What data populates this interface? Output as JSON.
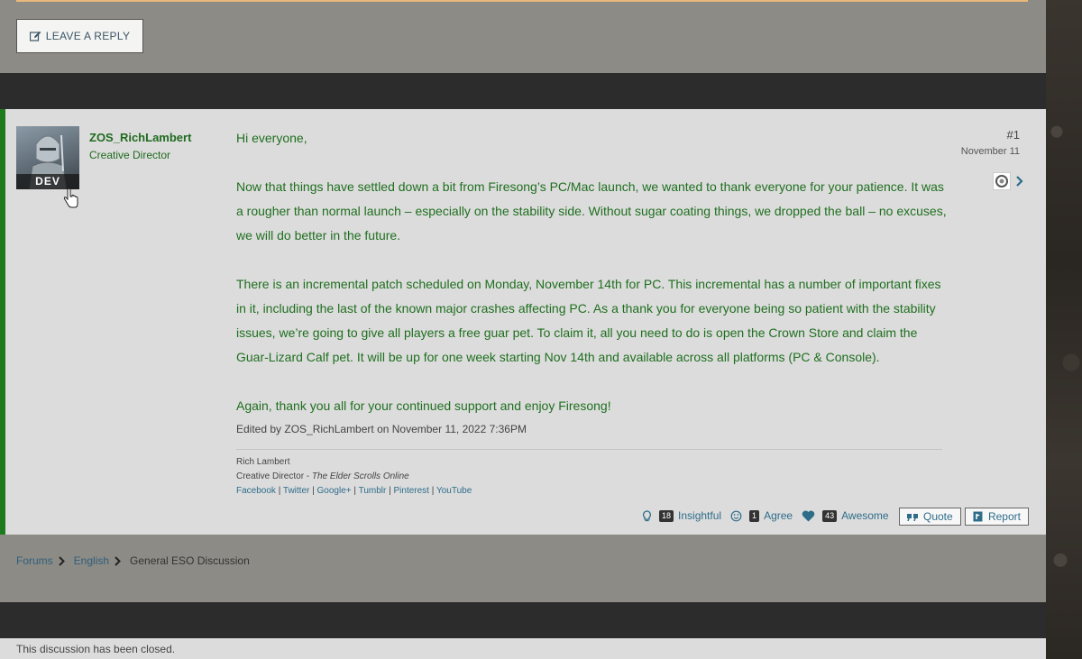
{
  "reply_button": {
    "label": "LEAVE A REPLY"
  },
  "post": {
    "author": {
      "name": "ZOS_RichLambert",
      "role": "Creative Director",
      "badge": "DEV"
    },
    "number": "#1",
    "date": "November 11",
    "paragraphs": [
      "Hi everyone,",
      "Now that things have settled down a bit from Firesong’s PC/Mac launch, we wanted to thank everyone for your patience. It was a rougher than normal launch – especially on the stability side. Without sugar coating things, we dropped the ball – no excuses, we will do better in the future.",
      "There is an incremental patch scheduled on Monday, November 14th for PC. This incremental has a number of important fixes in it, including the last of the known major crashes affecting PC. As a thank you for everyone being so patient with the stability issues, we’re going to give all players a free guar pet. To claim it, all you need to do is open the Crown Store and claim the Guar-Lizard Calf pet. It will be up for one week starting Nov 14th and available across all platforms (PC & Console).",
      "Again, thank you all for your continued support and enjoy Firesong!"
    ],
    "edited": "Edited by ZOS_RichLambert on November 11, 2022 7:36PM",
    "signature": {
      "name": "Rich Lambert",
      "title_prefix": "Creative Director - ",
      "title_game": "The Elder Scrolls Online",
      "links": [
        "Facebook",
        "Twitter",
        "Google+",
        "Tumblr",
        "Pinterest",
        "YouTube"
      ],
      "separator": " | "
    },
    "reactions": [
      {
        "icon": "lightbulb-icon",
        "count": "18",
        "label": "Insightful"
      },
      {
        "icon": "smiley-icon",
        "count": "1",
        "label": "Agree"
      },
      {
        "icon": "heart-icon",
        "count": "43",
        "label": "Awesome"
      }
    ],
    "quote_label": "Quote",
    "report_label": "Report"
  },
  "breadcrumbs": {
    "items": [
      "Forums",
      "English"
    ],
    "current": "General ESO Discussion"
  },
  "closed_notice": "This discussion has been closed.",
  "colors": {
    "accent_green": "#1d7a1d",
    "link_blue": "#2e6d8a",
    "top_accent": "#e9b97a"
  }
}
